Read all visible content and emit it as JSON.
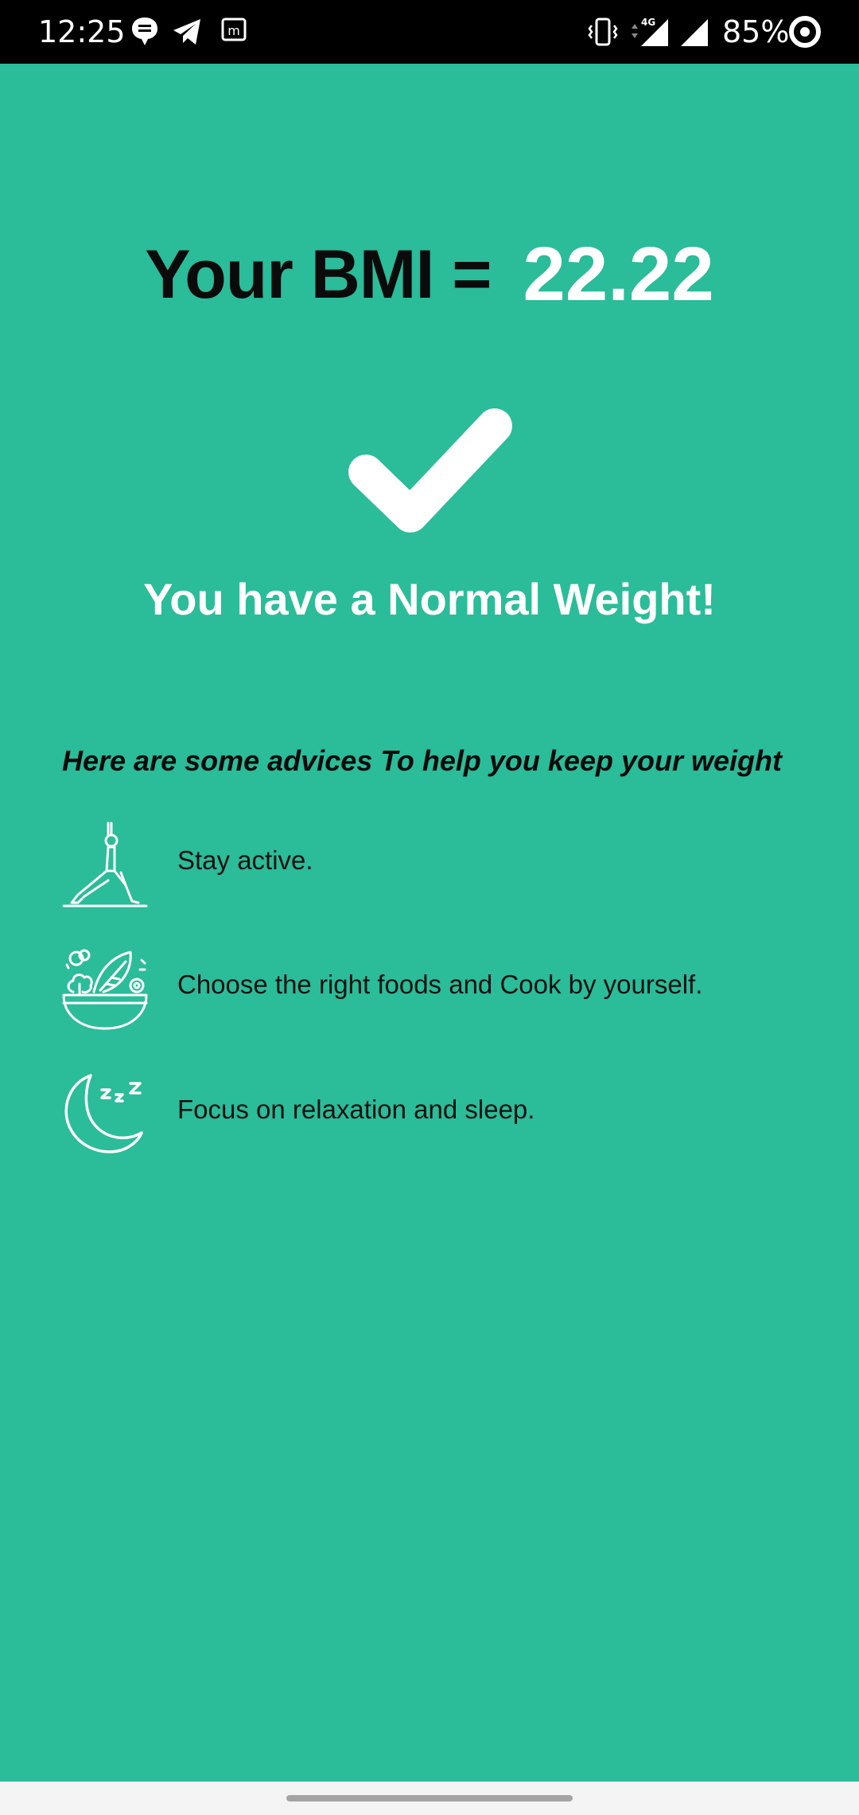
{
  "status_bar": {
    "time": "12:25",
    "battery": "85%",
    "network": "4G",
    "icons": [
      "chat-bubble-icon",
      "telegram-icon",
      "app-m-icon",
      "vibrate-icon",
      "signal-4g-icon",
      "signal-icon",
      "battery-ring-icon"
    ]
  },
  "bmi": {
    "label": "Your BMI =",
    "value": "22.22"
  },
  "result": {
    "icon": "checkmark-icon",
    "text": "You have a Normal Weight!"
  },
  "advice": {
    "heading": "Here are some advices To help you keep your weight",
    "items": [
      {
        "icon": "yoga-pose-icon",
        "text": "Stay active."
      },
      {
        "icon": "salad-bowl-icon",
        "text": "Choose the right foods and Cook by yourself."
      },
      {
        "icon": "moon-sleep-icon",
        "text": "Focus on relaxation and sleep."
      }
    ]
  },
  "colors": {
    "background": "#2bbc99",
    "accent_text": "#ffffff",
    "dark_text": "#0b0b0b"
  }
}
